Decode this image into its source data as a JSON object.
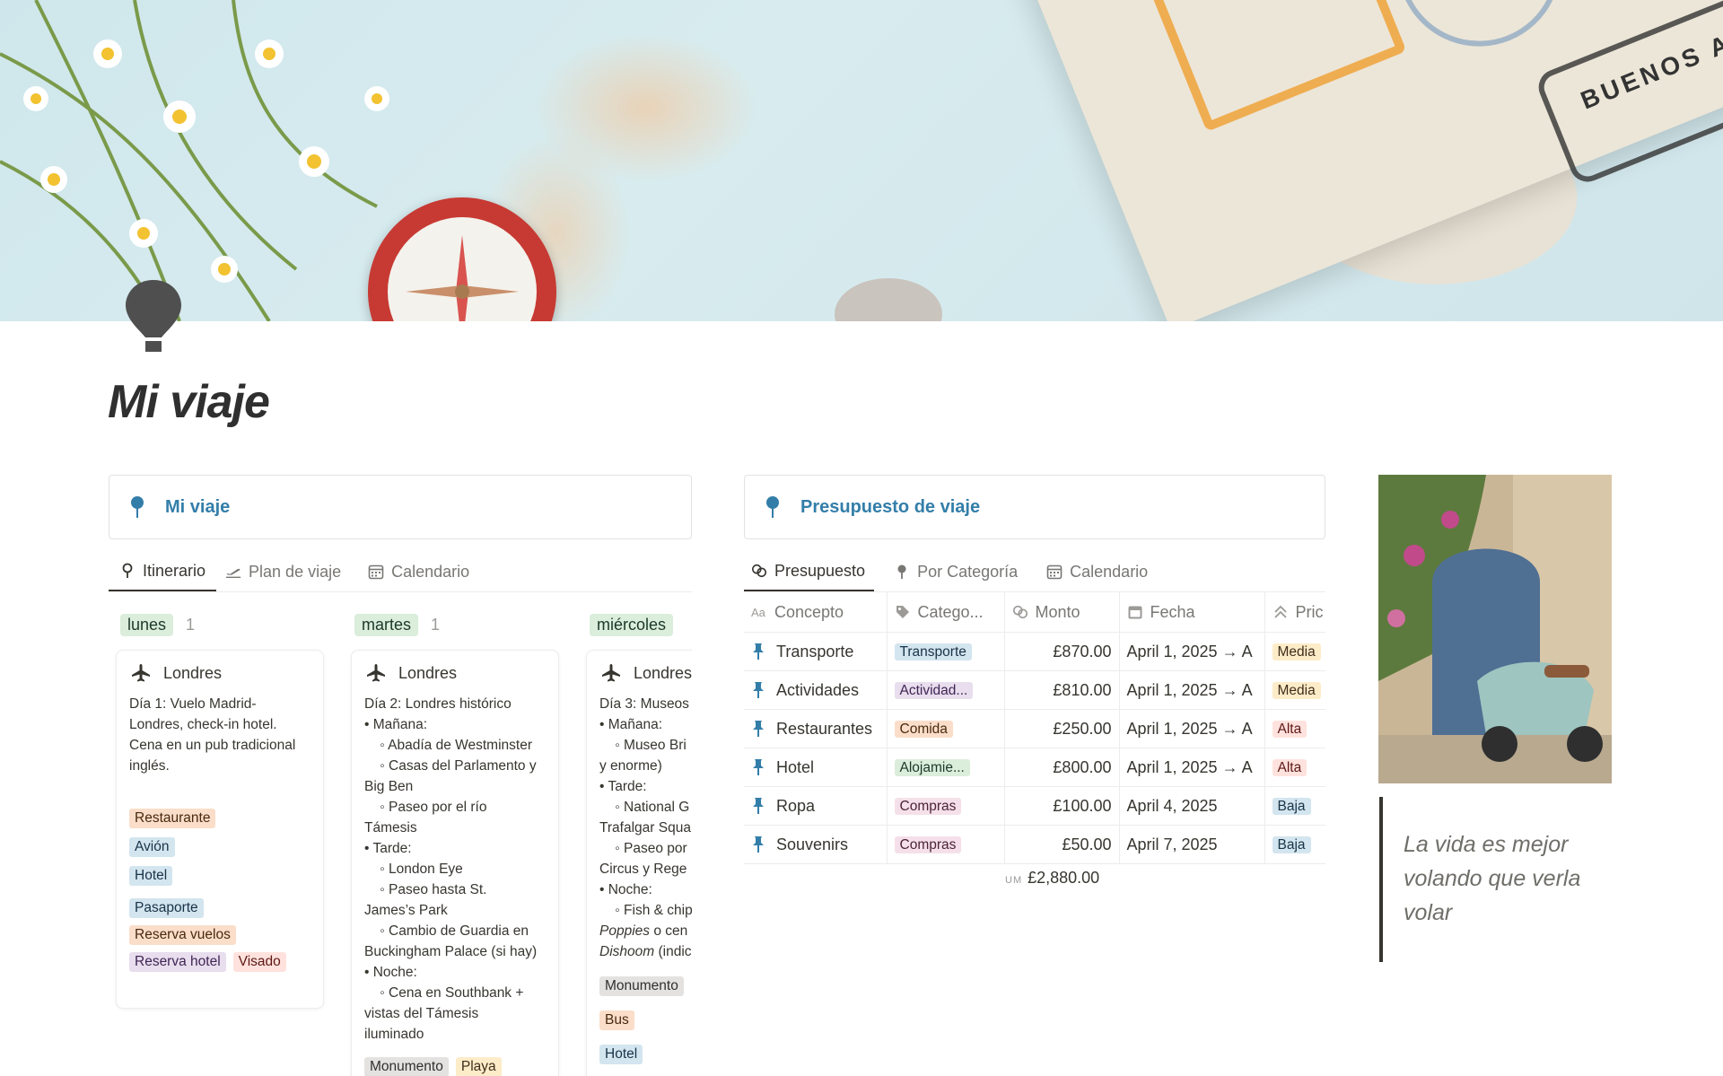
{
  "page": {
    "title": "Mi viaje"
  },
  "cover": {
    "stamp_text": "BUENOS AIRES"
  },
  "itinerary": {
    "callout_title": "Mi viaje",
    "tabs": [
      {
        "label": "Itinerario",
        "icon": "pin-icon"
      },
      {
        "label": "Plan de viaje",
        "icon": "airplane-takeoff-icon"
      },
      {
        "label": "Calendario",
        "icon": "calendar-icon"
      }
    ],
    "groups": [
      {
        "name": "lunes",
        "count": "1",
        "card": {
          "title": "Londres",
          "body": "Día 1: Vuelo Madrid-\nLondres, check-in hotel.\nCena en un pub tradicional\ninglés.",
          "tags_single": [
            "Restaurante",
            "Avión",
            "Hotel"
          ],
          "tags_multi": [
            "Pasaporte",
            "Reserva vuelos",
            "Reserva hotel",
            "Visado"
          ]
        }
      },
      {
        "name": "martes",
        "count": "1",
        "card": {
          "title": "Londres",
          "body": "Día 2: Londres histórico\n• Mañana:\n    ◦ Abadía de Westminster\n    ◦ Casas del Parlamento y\nBig Ben\n    ◦ Paseo por el río\nTámesis\n• Tarde:\n    ◦ London Eye\n    ◦ Paseo hasta St.\nJames’s Park\n    ◦ Cambio de Guardia en\nBuckingham Palace (si hay)\n• Noche:\n    ◦ Cena en Southbank +\nvistas del Támesis\niluminado",
          "tags": [
            "Monumento",
            "Playa"
          ]
        }
      },
      {
        "name": "miércoles",
        "count": "",
        "card": {
          "title": "Londres",
          "body_lines": [
            "Día 3: Museos",
            "• Mañana:",
            "    ◦ Museo Bri",
            "y enorme)",
            "• Tarde:",
            "    ◦ National G",
            "Trafalgar Squa",
            "    ◦ Paseo por",
            "Circus y Rege",
            "• Noche:",
            "    ◦ Fish & chip"
          ],
          "body_italic_1": "Poppies",
          "body_rest_1": " o cen",
          "body_italic_2": "Dishoom",
          "body_rest_2": " (indic",
          "tags": [
            "Monumento",
            "Bus",
            "Hotel"
          ]
        }
      }
    ]
  },
  "budget": {
    "callout_title": "Presupuesto de viaje",
    "tabs": [
      {
        "label": "Presupuesto",
        "icon": "money-exchange-icon"
      },
      {
        "label": "Por Categoría",
        "icon": "pin-icon"
      },
      {
        "label": "Calendario",
        "icon": "calendar-icon"
      }
    ],
    "columns": [
      {
        "label": "Concepto",
        "icon": "text-property-icon"
      },
      {
        "label": "Catego...",
        "icon": "tag-icon"
      },
      {
        "label": "Monto",
        "icon": "money-exchange-icon"
      },
      {
        "label": "Fecha",
        "icon": "calendar-icon"
      },
      {
        "label": "Pric",
        "icon": "priority-icon"
      }
    ],
    "rows": [
      {
        "concept": "Transporte",
        "category": "Transporte",
        "cat_color": "t-blue",
        "amount": "£870.00",
        "date": "April 1, 2025 → A",
        "priority": "Media",
        "pri_color": "t-yellow"
      },
      {
        "concept": "Actividades",
        "category": "Actividad...",
        "cat_color": "t-purple",
        "amount": "£810.00",
        "date": "April 1, 2025 → A",
        "priority": "Media",
        "pri_color": "t-yellow"
      },
      {
        "concept": "Restaurantes",
        "category": "Comida",
        "cat_color": "t-orange",
        "amount": "£250.00",
        "date": "April 1, 2025 → A",
        "priority": "Alta",
        "pri_color": "t-red"
      },
      {
        "concept": "Hotel",
        "category": "Alojamie...",
        "cat_color": "t-green",
        "amount": "£800.00",
        "date": "April 1, 2025 → A",
        "priority": "Alta",
        "pri_color": "t-red"
      },
      {
        "concept": "Ropa",
        "category": "Compras",
        "cat_color": "t-pink",
        "amount": "£100.00",
        "date": "April 4, 2025",
        "priority": "Baja",
        "pri_color": "t-blue"
      },
      {
        "concept": "Souvenirs",
        "category": "Compras",
        "cat_color": "t-pink",
        "amount": "£50.00",
        "date": "April 7, 2025",
        "priority": "Baja",
        "pri_color": "t-blue"
      }
    ],
    "sum_label": "UM",
    "sum_value": "£2,880.00"
  },
  "quote": {
    "text": "La vida es mejor volando que verla volar"
  },
  "colors": {
    "accent_blue": "#337ea9",
    "text": "#37352f",
    "muted": "#787774"
  }
}
